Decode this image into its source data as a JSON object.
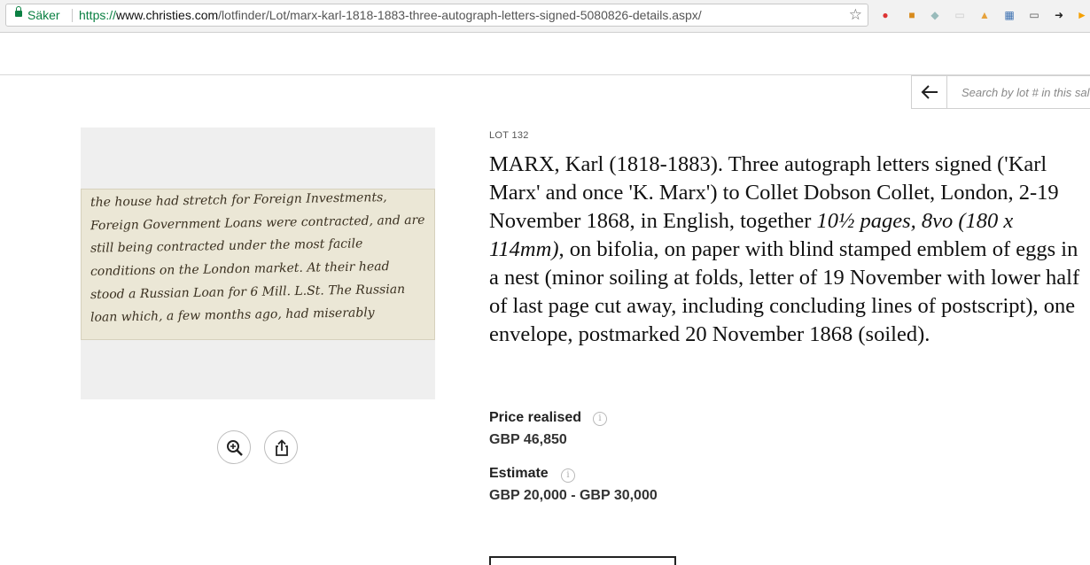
{
  "browser": {
    "secure_label": "Säker",
    "url_scheme": "https://",
    "url_host": "www.christies.com",
    "url_path": "/lotfinder/Lot/marx-karl-1818-1883-three-autograph-letters-signed-5080826-details.aspx/"
  },
  "search": {
    "placeholder": "Search by lot # in this sale"
  },
  "lot": {
    "number_label": "LOT 132",
    "title_part1": "MARX, Karl (1818-1883). Three autograph letters signed ('Karl Marx' and once 'K. Marx') to Collet Dobson Collet, London, 2-19 November 1868, in English, together ",
    "title_italic": "10½ pages, 8vo  (180 x 114mm)",
    "title_part2": ", on bifolia, on paper with blind stamped emblem of eggs in a nest (minor soiling at folds, letter of 19 November with lower half of last page cut away, including concluding lines of postscript), one envelope, postmarked 20 November 1868 (soiled)."
  },
  "price": {
    "label": "Price realised",
    "value": "GBP 46,850"
  },
  "estimate": {
    "label": "Estimate",
    "value": "GBP 20,000 - GBP 30,000"
  },
  "handwriting": [
    "the house had stretch for Foreign Investments,",
    "Foreign Government Loans were contracted, and are",
    "still being contracted under the most facile",
    "conditions on the London market. At their head",
    "stood a Russian Loan for 6 Mill. L.St. The Russian",
    "loan which, a few months ago, had miserably"
  ],
  "colors": {
    "secure_green": "#0b8043",
    "letter_paper": "#ebe7d6"
  }
}
